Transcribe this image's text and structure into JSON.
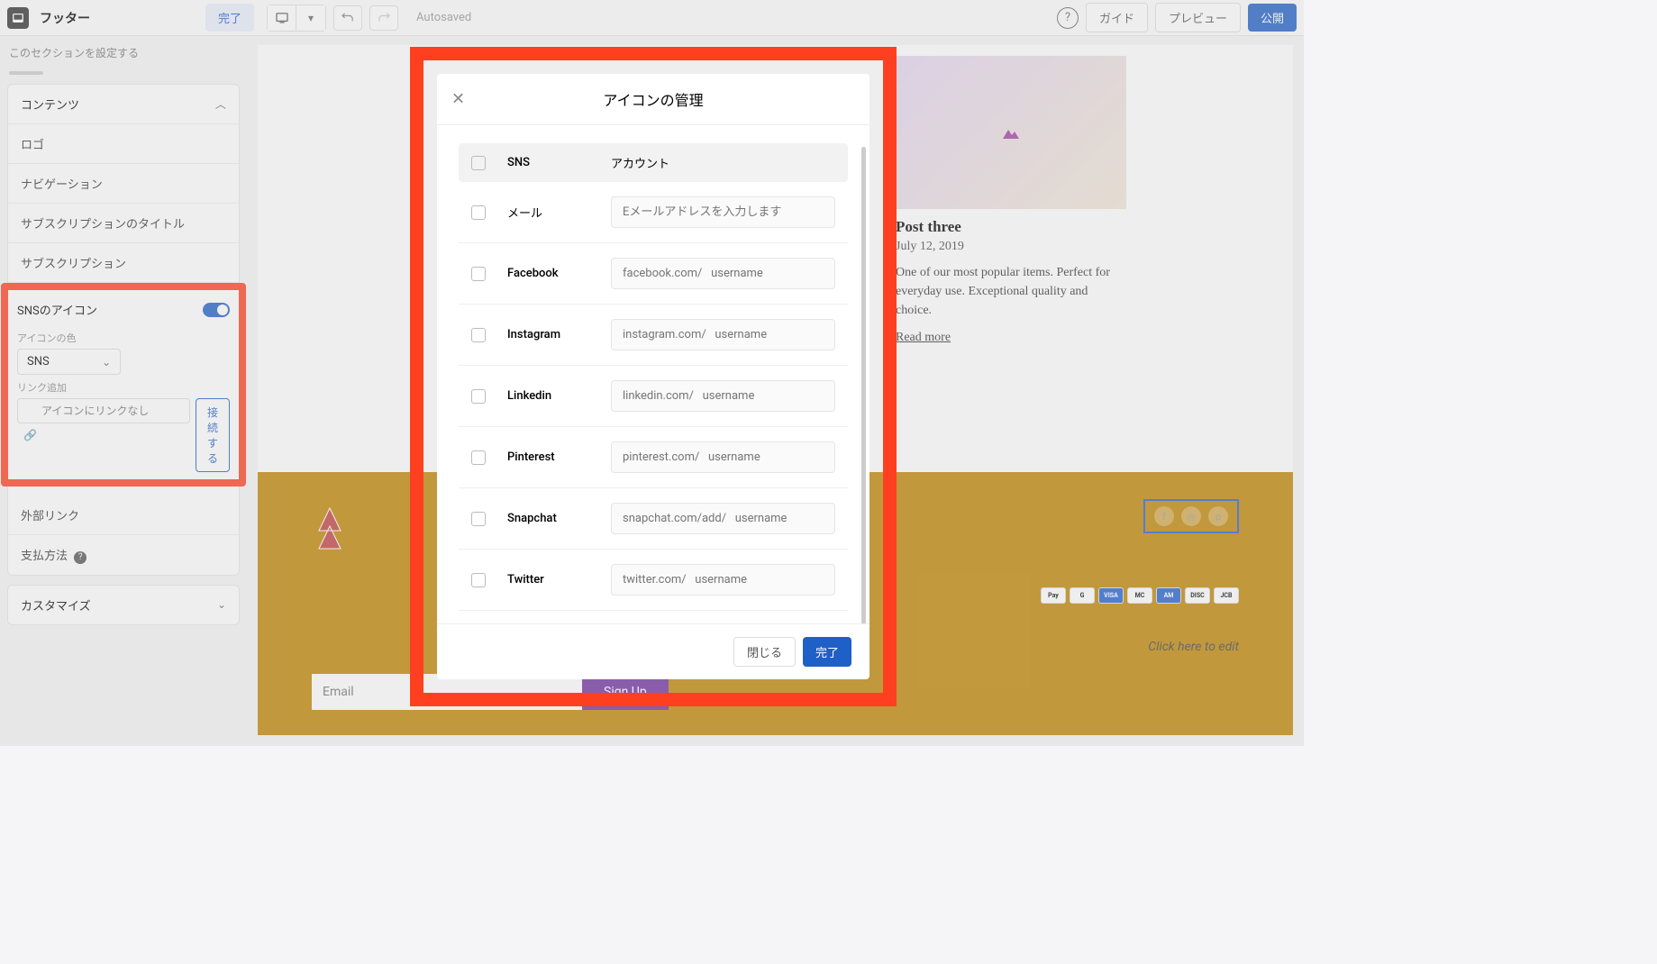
{
  "topbar": {
    "title": "フッター",
    "done": "完了",
    "autosaved": "Autosaved",
    "guide": "ガイド",
    "preview": "プレビュー",
    "publish": "公開"
  },
  "sidebar": {
    "desc": "このセクションを設定する",
    "contents_header": "コンテンツ",
    "items": {
      "logo": "ロゴ",
      "navigation": "ナビゲーション",
      "subscription_title": "サブスクリプションのタイトル",
      "subscription": "サブスクリプション",
      "external_links": "外部リンク",
      "payment": "支払方法"
    },
    "sns": {
      "label": "SNSのアイコン",
      "color_label": "アイコンの色",
      "color_value": "SNS",
      "link_label": "リンク追加",
      "link_placeholder": "アイコンにリンクなし",
      "connect": "接続する"
    },
    "customize_header": "カスタマイズ"
  },
  "modal": {
    "title": "アイコンの管理",
    "col_sns": "SNS",
    "col_account": "アカウント",
    "close": "閉じる",
    "done": "完了",
    "rows": [
      {
        "name": "メール",
        "placeholder": "Eメールアドレスを入力します"
      },
      {
        "name": "Facebook",
        "placeholder": "facebook.com/   username"
      },
      {
        "name": "Instagram",
        "placeholder": "instagram.com/   username"
      },
      {
        "name": "Linkedin",
        "placeholder": "linkedin.com/   username"
      },
      {
        "name": "Pinterest",
        "placeholder": "pinterest.com/   username"
      },
      {
        "name": "Snapchat",
        "placeholder": "snapchat.com/add/   username"
      },
      {
        "name": "Twitter",
        "placeholder": "twitter.com/   username"
      }
    ]
  },
  "canvas": {
    "post3": {
      "title": "Post three",
      "date": "July 12, 2019",
      "desc": "One of our most popular items. Perfect for everyday use. Exceptional quality and choice.",
      "link": "Read more"
    },
    "footer": {
      "email_placeholder": "Email",
      "signup": "Sign Up",
      "edit_hint": "Click here to edit",
      "payments": [
        "Pay",
        "G",
        "VISA",
        "MC",
        "AM",
        "DISC",
        "JCB"
      ]
    }
  }
}
